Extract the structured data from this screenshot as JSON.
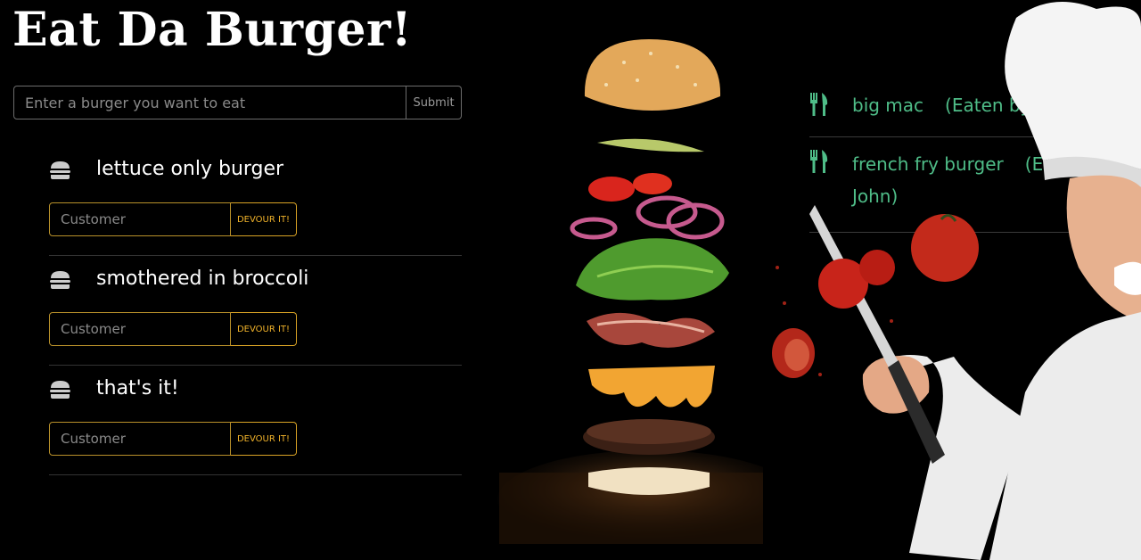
{
  "header": {
    "title": "Eat Da Burger!"
  },
  "add_form": {
    "placeholder": "Enter a burger you want to eat",
    "value": "",
    "submit_label": "Submit"
  },
  "uneaten": [
    {
      "name": "lettuce only burger",
      "customer_placeholder": "Customer",
      "button_label": "DEVOUR IT!"
    },
    {
      "name": "smothered in broccoli",
      "customer_placeholder": "Customer",
      "button_label": "DEVOUR IT!"
    },
    {
      "name": "that's it!",
      "customer_placeholder": "Customer",
      "button_label": "DEVOUR IT!"
    }
  ],
  "eaten": [
    {
      "name": "big mac",
      "by": "(Eaten by Chris)"
    },
    {
      "name": "french fry burger",
      "by": "(Eaten by John)"
    }
  ],
  "icons": {
    "uneaten_item": "burger-icon",
    "eaten_item": "utensils-icon"
  },
  "colors": {
    "background": "#000000",
    "devour_button": "#f0b22a",
    "eaten_text": "#4fbd88",
    "text": "#ffffff"
  }
}
